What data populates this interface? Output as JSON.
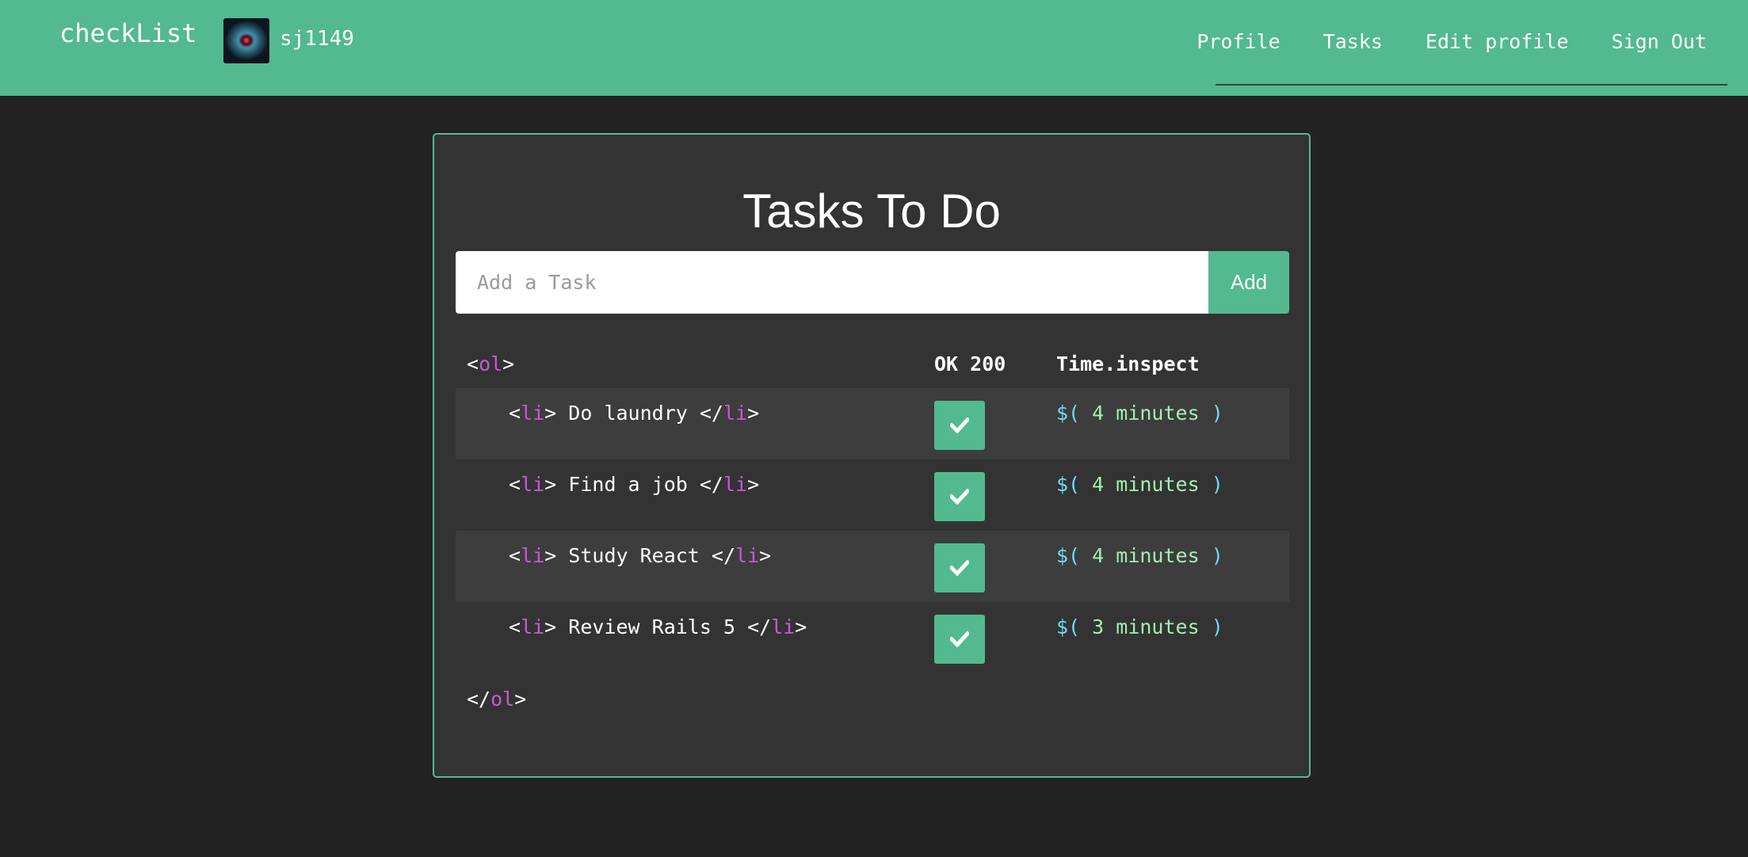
{
  "navbar": {
    "brand": "checkList",
    "username": "sj1149",
    "links": [
      "Profile",
      "Tasks",
      "Edit profile",
      "Sign Out"
    ],
    "bg_color": "#52b990"
  },
  "panel": {
    "title": "Tasks To Do",
    "input_placeholder": "Add a Task",
    "add_label": "Add"
  },
  "table": {
    "open_tag": {
      "lt": "<",
      "name": "ol",
      "gt": ">"
    },
    "close_tag": {
      "lt": "</",
      "name": "ol",
      "gt": ">"
    },
    "col_ok": "OK 200",
    "col_time": "Time.inspect"
  },
  "tasks": [
    {
      "text": " Do laundry ",
      "time": " 4 minutes "
    },
    {
      "text": " Find a job ",
      "time": " 4 minutes "
    },
    {
      "text": " Study React ",
      "time": " 4 minutes "
    },
    {
      "text": " Review Rails 5 ",
      "time": " 3 minutes "
    }
  ],
  "li": {
    "open_lt": "<",
    "open_gt": ">",
    "close_lt": "</",
    "close_gt": ">",
    "name": "li"
  },
  "time_format": {
    "prefix": "$(",
    "suffix": ")"
  },
  "colors": {
    "accent": "#52b990",
    "tag": "#c957d6",
    "time_paren": "#6fdcf4",
    "time_value": "#a2f0b0",
    "background": "#222222",
    "panel": "#333333"
  },
  "icons": {
    "check": "check-icon",
    "avatar": "nebula-avatar"
  }
}
